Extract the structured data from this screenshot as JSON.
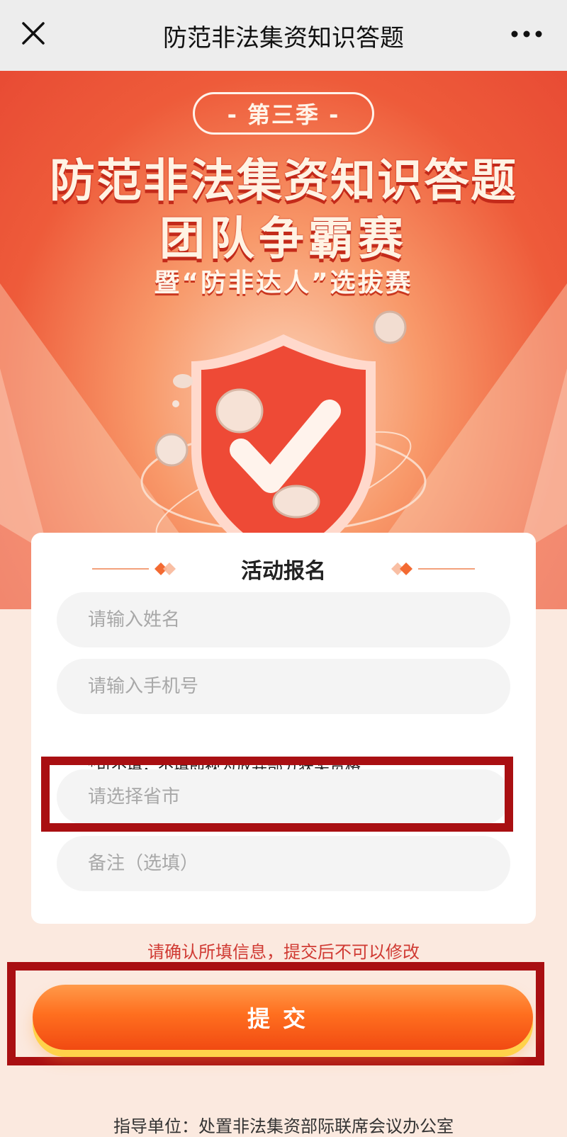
{
  "topbar": {
    "title": "防范非法集资知识答题",
    "close_icon": "close-icon",
    "more_icon": "more-icon"
  },
  "hero": {
    "season": "- 第三季 -",
    "title_line1": "防范非法集资知识答题",
    "title_line2": "团队争霸赛",
    "subtitle": "暨“防非达人”选拔赛",
    "illustration": "shield-check-icon"
  },
  "form": {
    "title": "活动报名",
    "name_placeholder": "请输入姓名",
    "phone_placeholder": "请输入手机号",
    "note": "*可不填，不填即视为放弃部分获奖资格",
    "region_placeholder": "请选择省市",
    "remark_placeholder": "备注（选填）"
  },
  "confirm_text": "请确认所填信息，提交后不可以修改",
  "submit_label": "提交",
  "footer": "指导单位：处置非法集资部际联席会议办公室",
  "colors": {
    "accent": "#e84b34",
    "button": "#ff6f1f",
    "highlight": "#a90f12"
  }
}
